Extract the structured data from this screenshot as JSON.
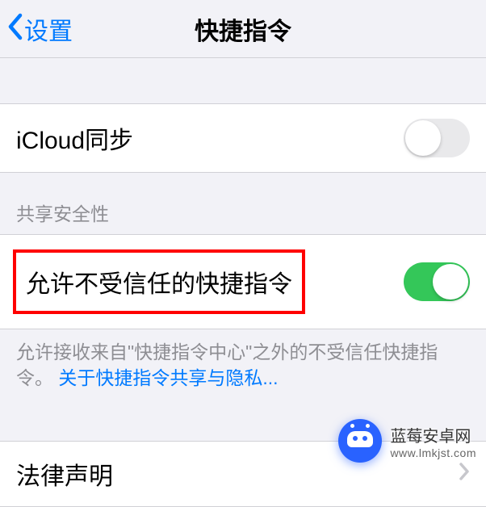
{
  "header": {
    "back_label": "设置",
    "title": "快捷指令"
  },
  "icloud": {
    "label": "iCloud同步",
    "enabled": false
  },
  "security": {
    "section_title": "共享安全性",
    "allow_untrusted_label": "允许不受信任的快捷指令",
    "allow_untrusted_enabled": true,
    "footer_text": "允许接收来自\"快捷指令中心\"之外的不受信任快捷指令。",
    "footer_link": "关于快捷指令共享与隐私..."
  },
  "legal": {
    "label": "法律声明"
  },
  "watermark": {
    "title": "蓝莓安卓网",
    "url": "www.lmkjst.com"
  }
}
